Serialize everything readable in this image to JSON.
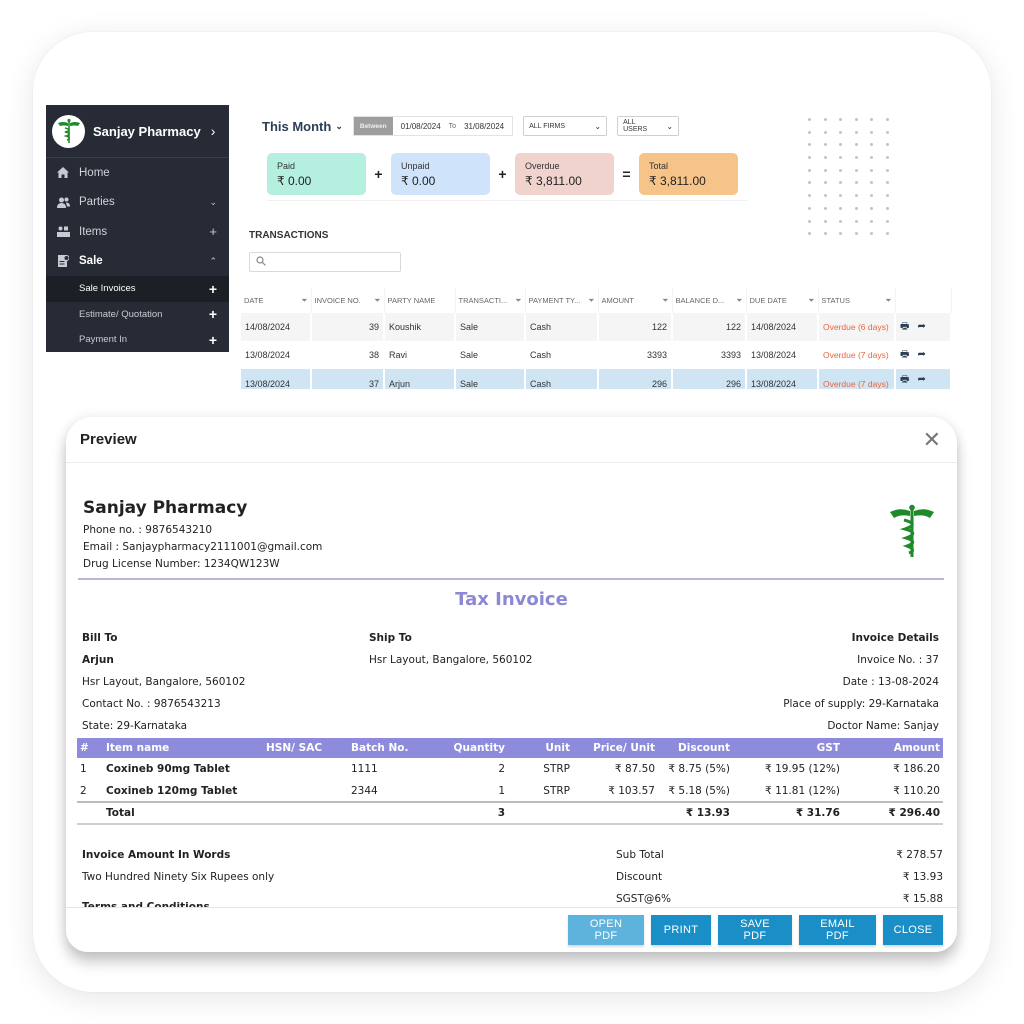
{
  "sidebar": {
    "brand": "Sanjay Pharmacy",
    "brand_chevron": "›",
    "items": [
      {
        "label": "Home",
        "icon": "home-icon",
        "action": ""
      },
      {
        "label": "Parties",
        "icon": "users-icon",
        "action": "⌄"
      },
      {
        "label": "Items",
        "icon": "items-icon",
        "action": "+"
      },
      {
        "label": "Sale",
        "icon": "sale-icon",
        "action": "⌃"
      }
    ],
    "sub_items": [
      {
        "label": "Sale Invoices",
        "action": "+",
        "active": true
      },
      {
        "label": "Estimate/ Quotation",
        "action": "+",
        "active": false
      },
      {
        "label": "Payment In",
        "action": "+",
        "active": false
      }
    ]
  },
  "filters": {
    "period": "This Month",
    "between_label": "Between",
    "from_date": "01/08/2024",
    "to_label": "To",
    "to_date": "31/08/2024",
    "firm_select": "ALL FIRMS",
    "user_select": "ALL USERS"
  },
  "summary": {
    "cards": [
      {
        "label": "Paid",
        "value": "₹ 0.00",
        "color": "#b5efe0"
      },
      {
        "label": "Unpaid",
        "value": "₹ 0.00",
        "color": "#cfe3fb"
      },
      {
        "label": "Overdue",
        "value": "₹ 3,811.00",
        "color": "#f0d3cc"
      },
      {
        "label": "Total",
        "value": "₹ 3,811.00",
        "color": "#f6c488"
      }
    ],
    "operators": [
      "+",
      "+",
      "="
    ]
  },
  "transactions": {
    "title": "TRANSACTIONS",
    "search_placeholder": "",
    "columns": [
      "DATE",
      "INVOICE NO.",
      "PARTY NAME",
      "TRANSACTI...",
      "PAYMENT TY...",
      "AMOUNT",
      "BALANCE D...",
      "DUE DATE",
      "STATUS"
    ],
    "rows": [
      {
        "date": "14/08/2024",
        "invoice_no": "39",
        "party": "Koushik",
        "type": "Sale",
        "payment": "Cash",
        "amount": "122",
        "balance": "122",
        "due_date": "14/08/2024",
        "status": "Overdue (6 days)"
      },
      {
        "date": "13/08/2024",
        "invoice_no": "38",
        "party": "Ravi",
        "type": "Sale",
        "payment": "Cash",
        "amount": "3393",
        "balance": "3393",
        "due_date": "13/08/2024",
        "status": "Overdue (7 days)"
      },
      {
        "date": "13/08/2024",
        "invoice_no": "37",
        "party": "Arjun",
        "type": "Sale",
        "payment": "Cash",
        "amount": "296",
        "balance": "296",
        "due_date": "13/08/2024",
        "status": "Overdue (7 days)"
      }
    ],
    "row_actions": [
      "print-icon",
      "share-icon"
    ]
  },
  "preview": {
    "title": "Preview",
    "close_glyph": "✕",
    "invoice": {
      "firm_name": "Sanjay Pharmacy",
      "phone": "Phone no. : 9876543210",
      "email": "Email : Sanjaypharmacy2111001@gmail.com",
      "license": "Drug License Number: 1234QW123W",
      "doc_title": "Tax Invoice",
      "bill_to": {
        "heading": "Bill To",
        "name": "Arjun",
        "address": "Hsr Layout, Bangalore, 560102",
        "contact": "Contact No. : 9876543213",
        "state": "State: 29-Karnataka"
      },
      "ship_to": {
        "heading": "Ship To",
        "address": "Hsr Layout, Bangalore, 560102"
      },
      "details": {
        "heading": "Invoice Details",
        "invoice_no": "Invoice No. : 37",
        "date": "Date : 13-08-2024",
        "place": "Place of supply: 29-Karnataka",
        "doctor": "Doctor Name: Sanjay"
      },
      "columns": [
        "#",
        "Item name",
        "HSN/ SAC",
        "Batch No.",
        "Quantity",
        "Unit",
        "Price/ Unit",
        "Discount",
        "GST",
        "Amount"
      ],
      "items": [
        {
          "no": "1",
          "name": "Coxineb 90mg Tablet",
          "hsn": "",
          "batch": "1111",
          "qty": "2",
          "unit": "STRP",
          "price": "₹ 87.50",
          "discount": "₹ 8.75 (5%)",
          "gst": "₹ 19.95 (12%)",
          "amount": "₹ 186.20"
        },
        {
          "no": "2",
          "name": "Coxineb 120mg Tablet",
          "hsn": "",
          "batch": "2344",
          "qty": "1",
          "unit": "STRP",
          "price": "₹ 103.57",
          "discount": "₹ 5.18 (5%)",
          "gst": "₹ 11.81 (12%)",
          "amount": "₹ 110.20"
        }
      ],
      "total": {
        "label": "Total",
        "qty": "3",
        "discount": "₹ 13.93",
        "gst": "₹ 31.76",
        "amount": "₹ 296.40"
      },
      "words_heading": "Invoice Amount In Words",
      "words": "Two Hundred Ninety Six Rupees only",
      "terms_heading": "Terms and Conditions",
      "summary": [
        {
          "label": "Sub Total",
          "value": "₹ 278.57"
        },
        {
          "label": "Discount",
          "value": "₹ 13.93"
        },
        {
          "label": "SGST@6%",
          "value": "₹ 15.88"
        }
      ]
    },
    "buttons": {
      "open_pdf": "OPEN PDF",
      "print": "PRINT",
      "save_pdf": "SAVE PDF",
      "email_pdf": "EMAIL PDF",
      "close": "CLOSE"
    }
  },
  "colors": {
    "sidebar_bg": "#262b35",
    "accent_purple": "#8f8bdc",
    "button_blue": "#1a8fc7",
    "overdue_red": "#e8663e",
    "logo_green": "#1f8a2a"
  }
}
